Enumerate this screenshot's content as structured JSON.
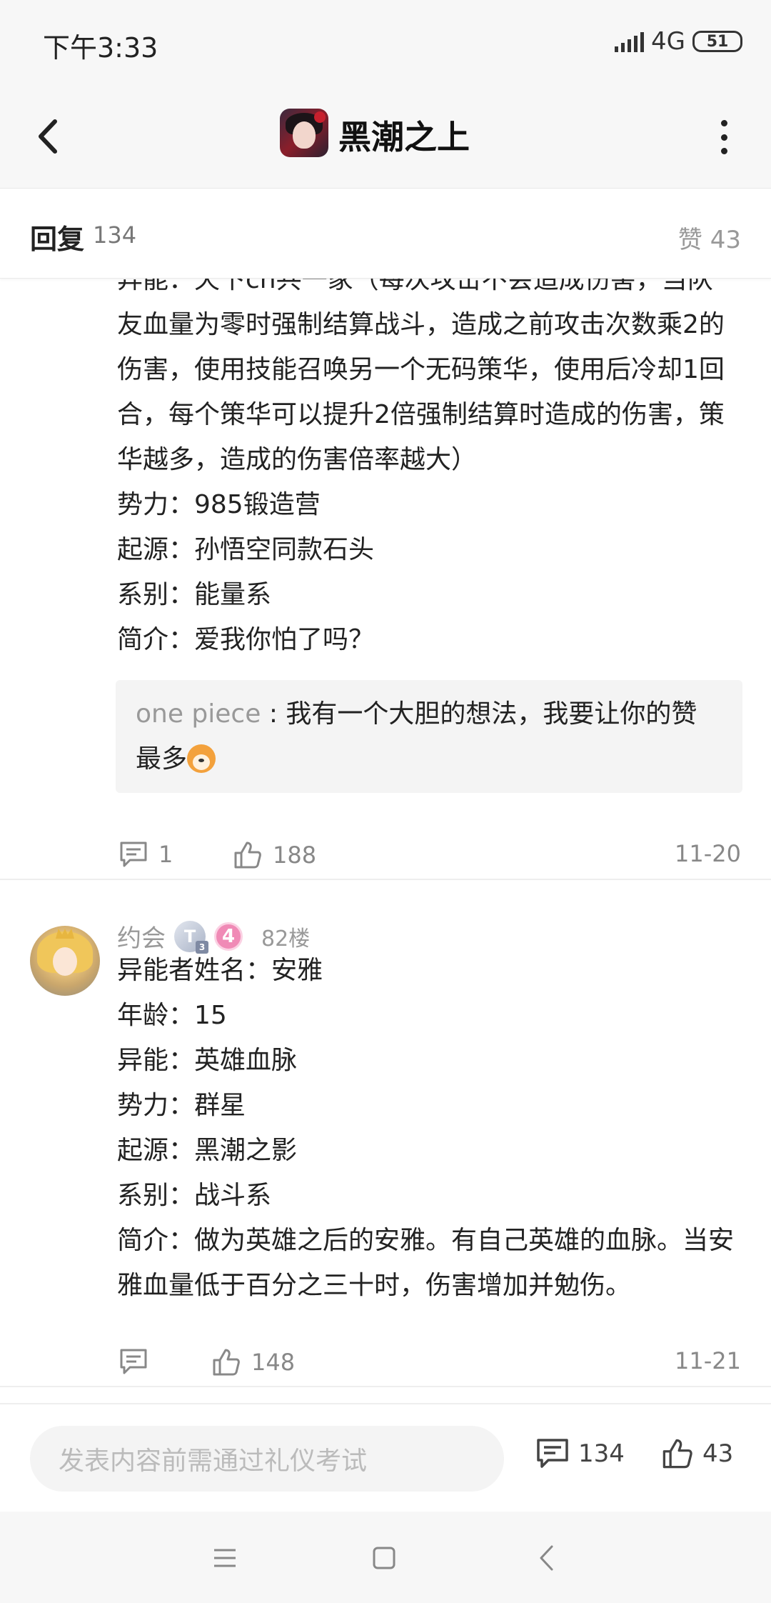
{
  "status_bar": {
    "time": "下午3:33",
    "network": "4G",
    "battery": "51"
  },
  "header": {
    "title": "黑潮之上"
  },
  "reply_bar": {
    "reply_label": "回复",
    "reply_count": "134",
    "like_label": "赞 43"
  },
  "post1": {
    "cut_line": "异能：天下cn共一家（每次攻击不会造成伤害，当队",
    "lines": [
      "友血量为零时强制结算战斗，造成之前攻击次数乘2的伤害，使用技能召唤另一个无码策华，使用后冷却1回合，每个策华可以提升2倍强制结算时造成的伤害，策华越多，造成的伤害倍率越大）",
      "势力：985锻造营",
      "起源：孙悟空同款石头",
      "系别：能量系",
      "简介：爱我你怕了吗？"
    ],
    "quote": {
      "user": "one piece",
      "separator": " : ",
      "text": "我有一个大胆的想法，我要让你的赞最多"
    },
    "comments": "1",
    "likes": "188",
    "date": "11-20"
  },
  "post2": {
    "username": "约会",
    "badge_t": "T",
    "badge_t_sub": "3",
    "badge_level": "4",
    "floor": "82楼",
    "lines": [
      "异能者姓名：安雅",
      "年龄：15",
      "异能：英雄血脉",
      "势力：群星",
      "起源：黑潮之影",
      "系别：战斗系",
      "简介：做为英雄之后的安雅。有自己英雄的血脉。当安雅血量低于百分之三十时，伤害增加并勉伤。"
    ],
    "likes": "148",
    "date": "11-21"
  },
  "input_bar": {
    "placeholder": "发表内容前需通过礼仪考试",
    "comment_count": "134",
    "like_count": "43"
  },
  "icons": {
    "back": "chevron-left-icon",
    "more": "more-vertical-icon",
    "comment": "comment-icon",
    "like": "thumb-up-icon",
    "menu": "menu-icon",
    "home": "square-icon",
    "nav_back": "chevron-left-icon"
  }
}
